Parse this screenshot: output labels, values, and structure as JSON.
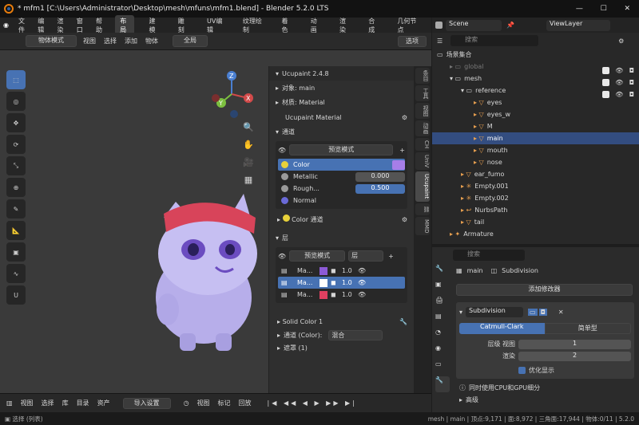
{
  "titlebar": {
    "title": "* mfm1 [C:\\Users\\Administrator\\Desktop\\mesh\\mfuns\\mfm1.blend] - Blender 5.2.0 LTS"
  },
  "menu": [
    "文件",
    "编辑",
    "渲染",
    "窗口",
    "帮助"
  ],
  "workspaces": [
    "布局",
    "建模",
    "雕刻",
    "UV编辑",
    "纹理绘制",
    "着色",
    "动画",
    "渲染",
    "合成",
    "几何节点"
  ],
  "scene": {
    "name": "Scene",
    "view_layer": "ViewLayer"
  },
  "vp_header": {
    "mode": "物体模式",
    "items": [
      "视图",
      "选择",
      "添加",
      "物体"
    ],
    "transform": "全局",
    "options": "选项"
  },
  "npanel": {
    "addon": "Ucupaint 2.4.8",
    "object_label": "对象: main",
    "material_label": "材质: Material",
    "ucu_material": "Ucupaint Material",
    "channels_title": "通道",
    "preview_btn": "预览模式",
    "channels": [
      {
        "name": "Color",
        "value": ""
      },
      {
        "name": "Metallic",
        "value": "0.000"
      },
      {
        "name": "Rough...",
        "value": "0.500"
      },
      {
        "name": "Normal",
        "value": ""
      }
    ],
    "color_channel": "Color 通道",
    "layers_title": "层",
    "layer_preview_btn": "预览模式",
    "layer_dropdown": "层",
    "layers": [
      {
        "name": "Ma...",
        "value": "1.0",
        "color": "#8c5ad6"
      },
      {
        "name": "Ma...",
        "value": "1.0",
        "color": "#ffffff"
      },
      {
        "name": "Ma...",
        "value": "1.0",
        "color": "#e04060"
      }
    ],
    "solid_color": "Solid Color 1",
    "channel_color_label": "通道 (Color):",
    "blend_mode": "混合",
    "mask": "遮罩 (1)"
  },
  "ntabs": [
    "条目",
    "工具",
    "视图",
    "动画",
    "CH",
    "UniV",
    "Ucupaint",
    "",
    "MMD"
  ],
  "outliner": {
    "search_placeholder": "搜索",
    "root": "场景集合",
    "items": [
      {
        "label": "global",
        "indent": 1
      },
      {
        "label": "mesh",
        "indent": 1
      },
      {
        "label": "reference",
        "indent": 2
      },
      {
        "label": "eyes",
        "indent": 3
      },
      {
        "label": "eyes_w",
        "indent": 3
      },
      {
        "label": "M",
        "indent": 3
      },
      {
        "label": "main",
        "indent": 3
      },
      {
        "label": "mouth",
        "indent": 3
      },
      {
        "label": "nose",
        "indent": 3
      },
      {
        "label": "ear_fumo",
        "indent": 2
      },
      {
        "label": "Empty.001",
        "indent": 2
      },
      {
        "label": "Empty.002",
        "indent": 2
      },
      {
        "label": "NurbsPath",
        "indent": 2
      },
      {
        "label": "tail",
        "indent": 2
      },
      {
        "label": "Armature",
        "indent": 1
      }
    ]
  },
  "props": {
    "search_placeholder": "搜索",
    "breadcrumb_obj": "main",
    "breadcrumb_mod": "Subdivision",
    "add_modifier": "添加修改器",
    "modifier_name": "Subdivision",
    "types": [
      "Catmull-Clark",
      "简单型"
    ],
    "levels_label": "层级 视图",
    "levels_value": "1",
    "render_label": "渲染",
    "render_value": "2",
    "optimal": "优化显示",
    "gpu_note": "同时使用CPU和GPU细分",
    "advanced": "高级"
  },
  "timeline": {
    "items": [
      "视图",
      "选择",
      "库",
      "目录",
      "资产"
    ],
    "import": "导入设置",
    "items2": [
      "视图",
      "标记",
      "回放"
    ]
  },
  "status": {
    "left": "选择",
    "left2": "(列表)",
    "right": "mesh | main | 顶点:9,171 | 面:8,972 | 三角面:17,944 | 物体:0/11 | 5.2.0"
  }
}
